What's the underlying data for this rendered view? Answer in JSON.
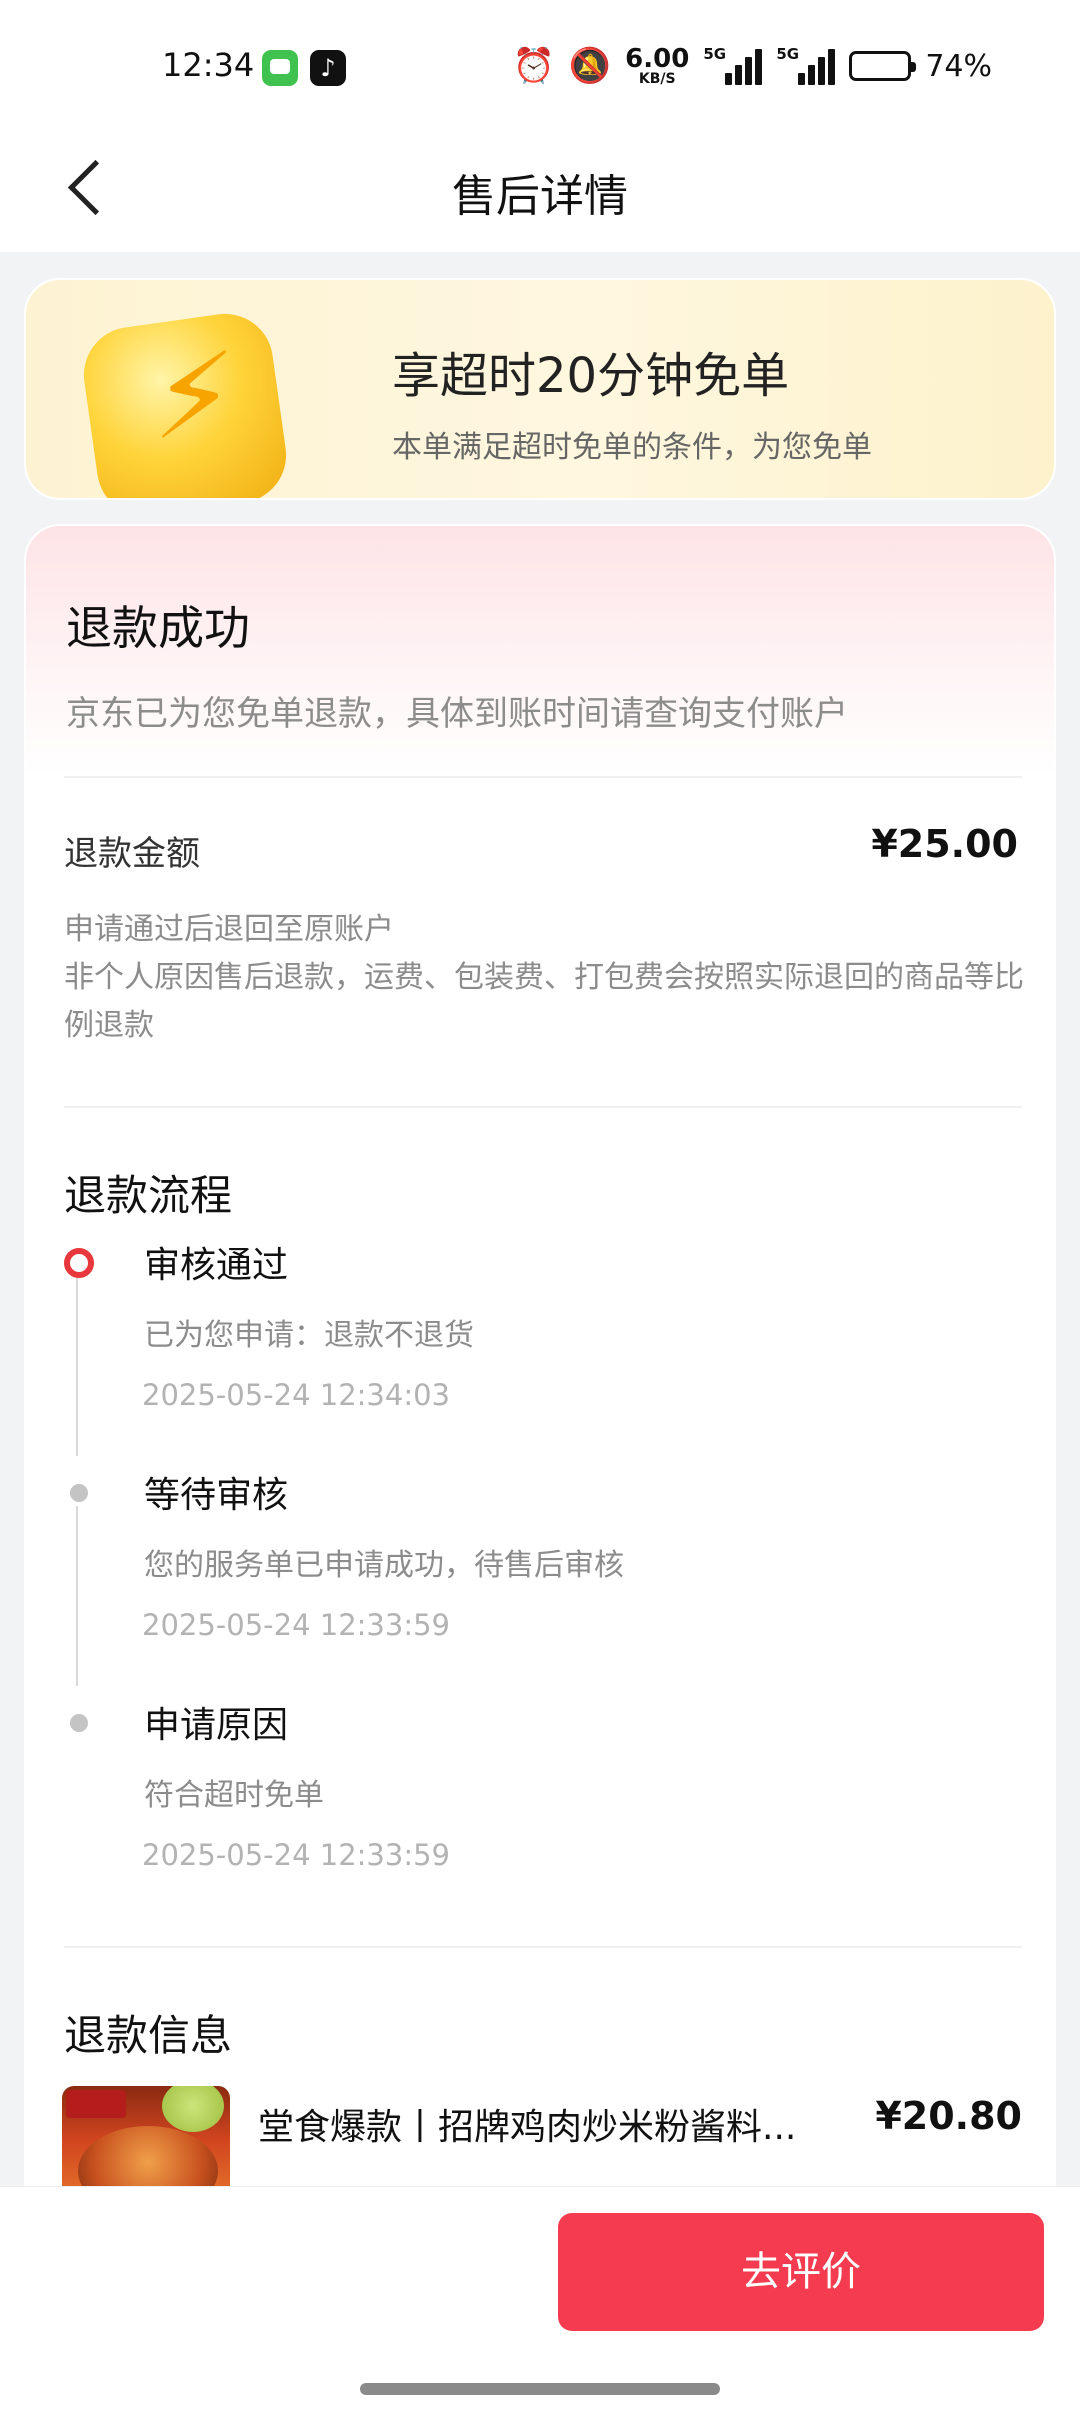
{
  "status_bar": {
    "time": "12:34",
    "net_speed_value": "6.00",
    "net_speed_unit": "KB/S",
    "sim1_label": "5G",
    "sim2_label": "5G",
    "battery_percent": "74%",
    "battery_level": 0.74
  },
  "nav": {
    "title": "售后详情"
  },
  "promo": {
    "title": "享超时20分钟免单",
    "subtitle": "本单满足超时免单的条件，为您免单"
  },
  "refund_status": {
    "title": "退款成功",
    "description": "京东已为您免单退款，具体到账时间请查询支付账户"
  },
  "refund_amount": {
    "label": "退款金额",
    "value": "¥25.00",
    "note_line1": "申请通过后退回至原账户",
    "note_line2": "非个人原因售后退款，运费、包装费、打包费会按照实际退回的商品等比例退款"
  },
  "refund_process": {
    "title": "退款流程",
    "steps": [
      {
        "title": "审核通过",
        "description": "已为您申请：退款不退货",
        "time": "2025-05-24 12:34:03"
      },
      {
        "title": "等待审核",
        "description": "您的服务单已申请成功，待售后审核",
        "time": "2025-05-24 12:33:59"
      },
      {
        "title": "申请原因",
        "description": "符合超时免单",
        "time": "2025-05-24 12:33:59"
      }
    ]
  },
  "refund_info": {
    "title": "退款信息",
    "product_name": "堂食爆款丨招牌鸡肉炒米粉酱料...",
    "product_price": "¥20.80"
  },
  "bottom": {
    "review_button": "去评价"
  }
}
